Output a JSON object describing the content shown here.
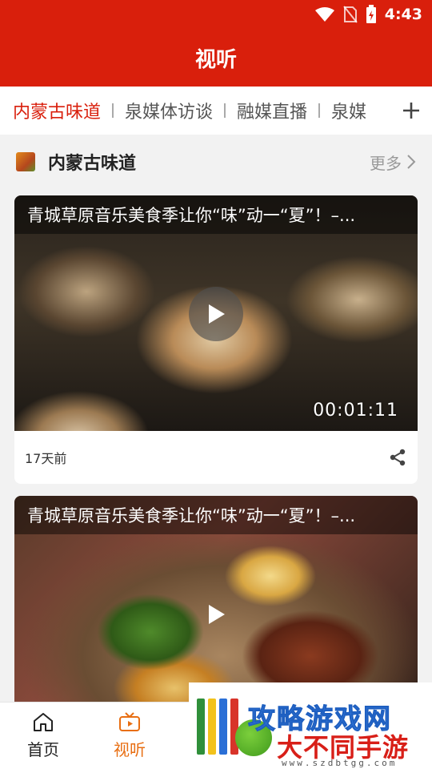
{
  "status_bar": {
    "time": "4:43"
  },
  "app_bar": {
    "title": "视听"
  },
  "tabs": {
    "items": [
      {
        "label": "内蒙古味道",
        "active": true
      },
      {
        "label": "泉媒体访谈",
        "active": false
      },
      {
        "label": "融媒直播",
        "active": false
      },
      {
        "label": "泉媒",
        "active": false
      }
    ]
  },
  "section": {
    "title": "内蒙古味道",
    "more_label": "更多"
  },
  "videos": [
    {
      "title": "青城草原音乐美食季让你“味”动一“夏”！–...",
      "duration": "00:01:11",
      "time_ago": "17天前"
    },
    {
      "title": "青城草原音乐美食季让你“味”动一“夏”！–..."
    }
  ],
  "bottom_nav": {
    "items": [
      {
        "label": "首页",
        "icon": "home-icon",
        "active": false
      },
      {
        "label": "视听",
        "icon": "tv-icon",
        "active": true
      }
    ]
  },
  "watermark": {
    "top": "攻略游戏网",
    "bottom": "大不同手游网",
    "url": "www.szdbtgg.com"
  },
  "colors": {
    "brand_red": "#d91f0c",
    "tab_active": "#d91f0c",
    "nav_active": "#e86e12"
  }
}
